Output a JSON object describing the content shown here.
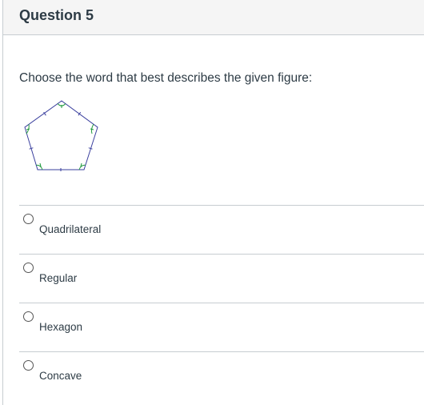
{
  "question": {
    "title": "Question 5",
    "prompt": "Choose the word that best describes the given figure:"
  },
  "answers": [
    {
      "label": "Quadrilateral",
      "selected": false
    },
    {
      "label": "Regular",
      "selected": false
    },
    {
      "label": "Hexagon",
      "selected": false
    },
    {
      "label": "Concave",
      "selected": false
    }
  ],
  "figure": {
    "shape": "pentagon-with-tick-marks-and-angle-arcs",
    "edge_color": "#3a3f9e",
    "arc_color": "#1f9a3c"
  }
}
